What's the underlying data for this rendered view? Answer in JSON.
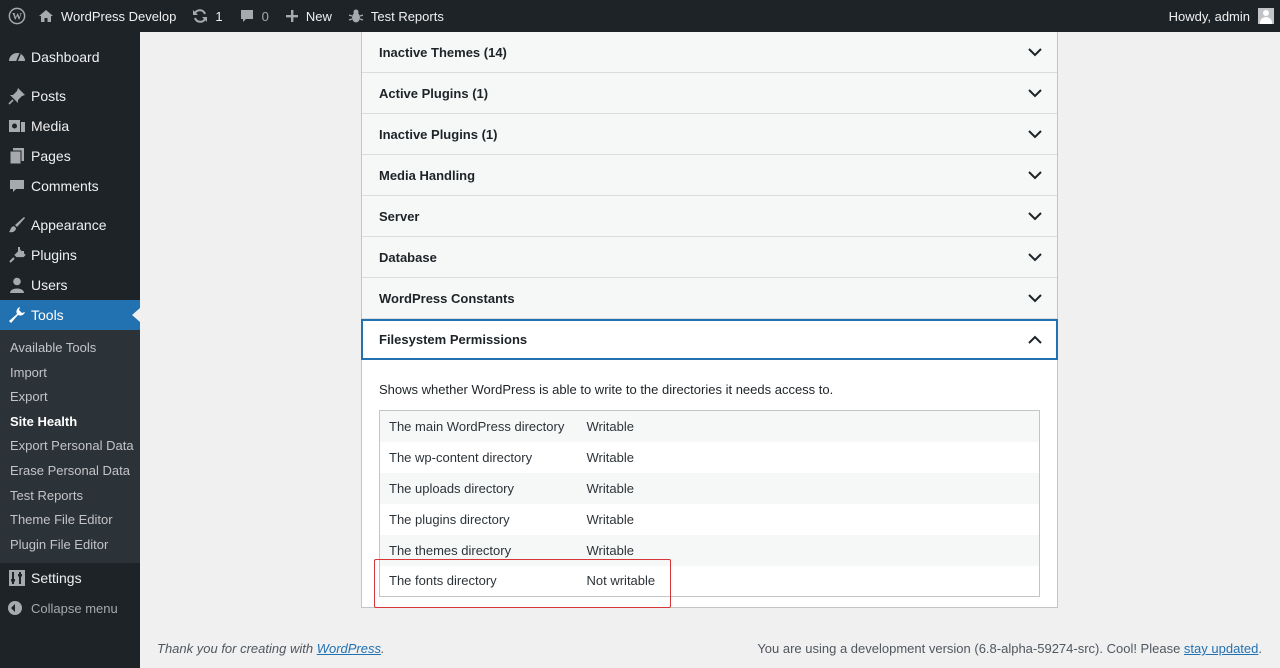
{
  "adminbar": {
    "site_name": "WordPress Develop",
    "updates_count": "1",
    "comments_count": "0",
    "new_label": "New",
    "test_reports_label": "Test Reports",
    "howdy": "Howdy, admin"
  },
  "sidebar": {
    "items": {
      "dashboard": "Dashboard",
      "posts": "Posts",
      "media": "Media",
      "pages": "Pages",
      "comments": "Comments",
      "appearance": "Appearance",
      "plugins": "Plugins",
      "users": "Users",
      "tools": "Tools",
      "settings": "Settings"
    },
    "submenu": [
      "Available Tools",
      "Import",
      "Export",
      "Site Health",
      "Export Personal Data",
      "Erase Personal Data",
      "Test Reports",
      "Theme File Editor",
      "Plugin File Editor"
    ],
    "collapse": "Collapse menu"
  },
  "accordion": [
    "Inactive Themes (14)",
    "Active Plugins (1)",
    "Inactive Plugins (1)",
    "Media Handling",
    "Server",
    "Database",
    "WordPress Constants"
  ],
  "filesystem": {
    "title": "Filesystem Permissions",
    "description": "Shows whether WordPress is able to write to the directories it needs access to.",
    "rows": [
      {
        "label": "The main WordPress directory",
        "value": "Writable"
      },
      {
        "label": "The wp-content directory",
        "value": "Writable"
      },
      {
        "label": "The uploads directory",
        "value": "Writable"
      },
      {
        "label": "The plugins directory",
        "value": "Writable"
      },
      {
        "label": "The themes directory",
        "value": "Writable"
      },
      {
        "label": "The fonts directory",
        "value": "Not writable"
      }
    ]
  },
  "footer": {
    "thanks_prefix": "Thank you for creating with ",
    "thanks_link": "WordPress",
    "thanks_suffix": ".",
    "version_text": "You are using a development version (6.8-alpha-59274-src). Cool! Please ",
    "version_link": "stay updated",
    "version_suffix": "."
  },
  "colors": {
    "admin_dark": "#1d2327",
    "accent": "#2271b1",
    "highlight": "#d63638"
  }
}
